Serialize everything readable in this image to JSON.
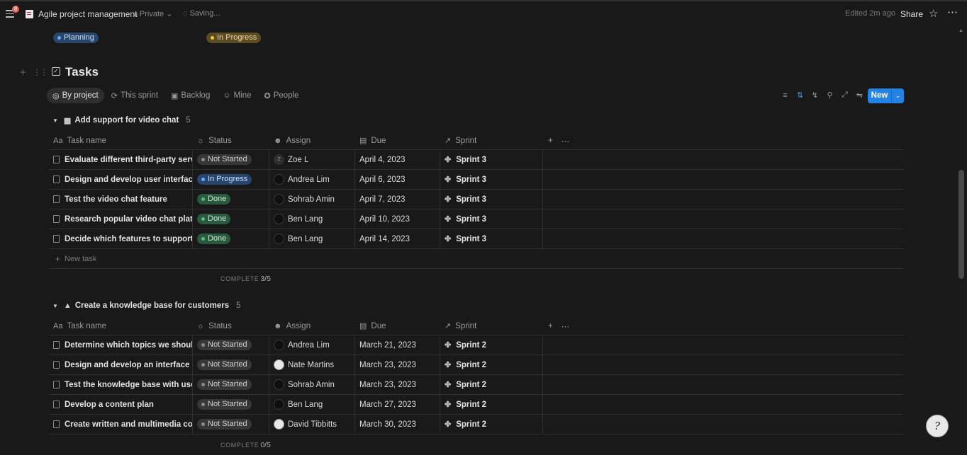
{
  "topbar": {
    "notif_count": "8",
    "title": "Agile project management",
    "privacy": "Private",
    "saving": "Saving...",
    "edited": "Edited 2m ago",
    "share": "Share"
  },
  "pills": {
    "planning": "Planning",
    "in_progress": "In Progress"
  },
  "heading": {
    "title": "Tasks"
  },
  "tabs": [
    {
      "label": "By project",
      "icon": "target-icon",
      "active": true
    },
    {
      "label": "This sprint",
      "icon": "refresh-icon"
    },
    {
      "label": "Backlog",
      "icon": "archive-icon"
    },
    {
      "label": "Mine",
      "icon": "user-icon"
    },
    {
      "label": "People",
      "icon": "people-icon"
    }
  ],
  "toolbar": {
    "new_label": "New",
    "accent": "#2383e2"
  },
  "columns": {
    "task": "Task name",
    "status": "Status",
    "assign": "Assign",
    "due": "Due",
    "sprint": "Sprint"
  },
  "groups": [
    {
      "title": "Add support for video chat",
      "count": "5",
      "complete_label": "COMPLETE",
      "complete_value": "3/5",
      "new_task": "New task",
      "rows": [
        {
          "task": "Evaluate different third-party services",
          "status": "Not Started",
          "assign": "Zoe L",
          "due": "April 4, 2023",
          "sprint": "Sprint 3"
        },
        {
          "task": "Design and develop user interface",
          "status": "In Progress",
          "assign": "Andrea Lim",
          "due": "April 6, 2023",
          "sprint": "Sprint 3"
        },
        {
          "task": "Test the video chat feature",
          "status": "Done",
          "assign": "Sohrab Amin",
          "due": "April 7, 2023",
          "sprint": "Sprint 3"
        },
        {
          "task": "Research popular video chat platforms",
          "status": "Done",
          "assign": "Ben Lang",
          "due": "April 10, 2023",
          "sprint": "Sprint 3"
        },
        {
          "task": "Decide which features to support",
          "status": "Done",
          "assign": "Ben Lang",
          "due": "April 14, 2023",
          "sprint": "Sprint 3"
        }
      ]
    },
    {
      "title": "Create a knowledge base for customers",
      "count": "5",
      "complete_label": "COMPLETE",
      "complete_value": "0/5",
      "rows": [
        {
          "task": "Determine which topics we should cover",
          "status": "Not Started",
          "assign": "Andrea Lim",
          "due": "March 21, 2023",
          "sprint": "Sprint 2"
        },
        {
          "task": "Design and develop an interface",
          "status": "Not Started",
          "assign": "Nate Martins",
          "due": "March 23, 2023",
          "sprint": "Sprint 2"
        },
        {
          "task": "Test the knowledge base with users",
          "status": "Not Started",
          "assign": "Sohrab Amin",
          "due": "March 23, 2023",
          "sprint": "Sprint 2"
        },
        {
          "task": "Develop a content plan",
          "status": "Not Started",
          "assign": "Ben Lang",
          "due": "March 27, 2023",
          "sprint": "Sprint 2"
        },
        {
          "task": "Create written and multimedia content",
          "status": "Not Started",
          "assign": "David Tibbitts",
          "due": "March 30, 2023",
          "sprint": "Sprint 2"
        }
      ]
    }
  ]
}
